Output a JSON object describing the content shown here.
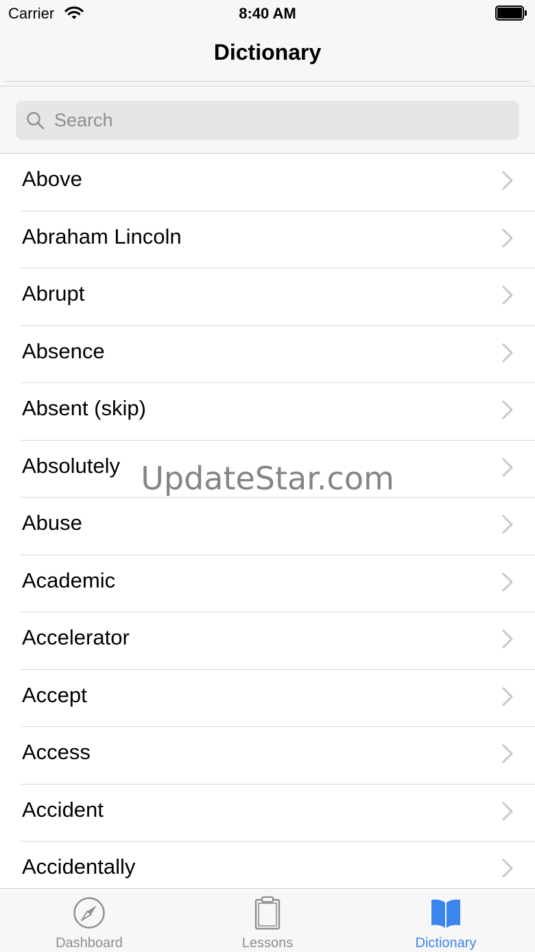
{
  "status_bar": {
    "carrier": "Carrier",
    "time": "8:40 AM"
  },
  "nav": {
    "title": "Dictionary"
  },
  "search": {
    "placeholder": "Search",
    "value": ""
  },
  "list": {
    "items": [
      "Above",
      "Abraham Lincoln",
      "Abrupt",
      "Absence",
      "Absent (skip)",
      "Absolutely",
      "Abuse",
      "Academic",
      "Accelerator",
      "Accept",
      "Access",
      "Accident",
      "Accidentally"
    ]
  },
  "watermark": "UpdateStar.com",
  "tabs": [
    {
      "label": "Dashboard",
      "icon": "compass-icon",
      "active": false
    },
    {
      "label": "Lessons",
      "icon": "clipboard-icon",
      "active": false
    },
    {
      "label": "Dictionary",
      "icon": "book-icon",
      "active": true
    }
  ],
  "colors": {
    "accent": "#3b86ee",
    "inactive": "#8e8e93",
    "bar_bg": "#f7f7f7"
  }
}
